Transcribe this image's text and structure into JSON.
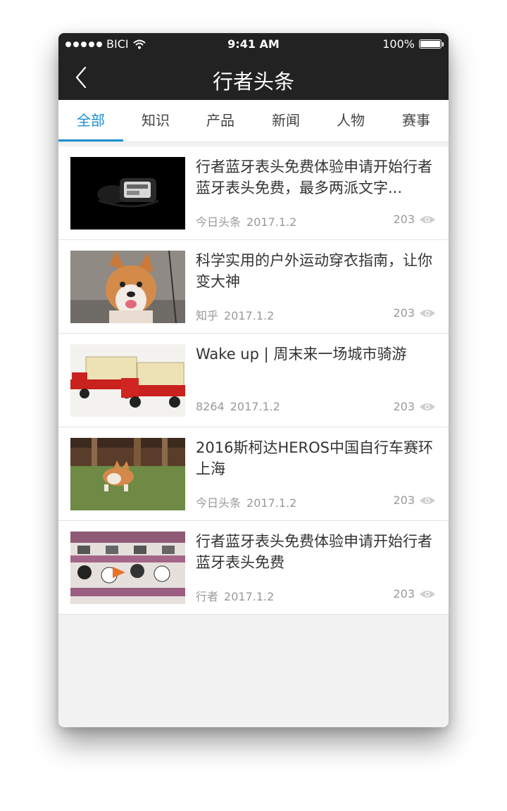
{
  "status_bar": {
    "carrier": "BICI",
    "time": "9:41 AM",
    "battery": "100%"
  },
  "nav": {
    "title": "行者头条"
  },
  "tabs": [
    {
      "label": "全部",
      "active": true
    },
    {
      "label": "知识",
      "active": false
    },
    {
      "label": "产品",
      "active": false
    },
    {
      "label": "新闻",
      "active": false
    },
    {
      "label": "人物",
      "active": false
    },
    {
      "label": "赛事",
      "active": false
    }
  ],
  "articles": [
    {
      "title": "行者蓝牙表头免费体验申请开始行者蓝牙表头免费，最多两派文字...",
      "source": "今日头条",
      "date": "2017.1.2",
      "views": "203",
      "image": "bike-computer-photo"
    },
    {
      "title": "科学实用的户外运动穿衣指南，让你变大神",
      "source": "知乎",
      "date": "2017.1.2",
      "views": "203",
      "image": "corgi-photo"
    },
    {
      "title": "Wake up | 周末来一场城市骑游",
      "source": "8264",
      "date": "2017.1.2",
      "views": "203",
      "image": "toy-trucks-photo"
    },
    {
      "title": "2016斯柯达HEROS中国自行车赛环上海",
      "source": "今日头条",
      "date": "2017.1.2",
      "views": "203",
      "image": "running-corgi-photo"
    },
    {
      "title": "行者蓝牙表头免费体验申请开始行者蓝牙表头免费",
      "source": "行者",
      "date": "2017.1.2",
      "views": "203",
      "image": "pattern-fabric-photo"
    }
  ],
  "colors": {
    "header_bg": "#222222",
    "accent": "#1a8fd0",
    "page_bg": "#f2f2f2"
  }
}
